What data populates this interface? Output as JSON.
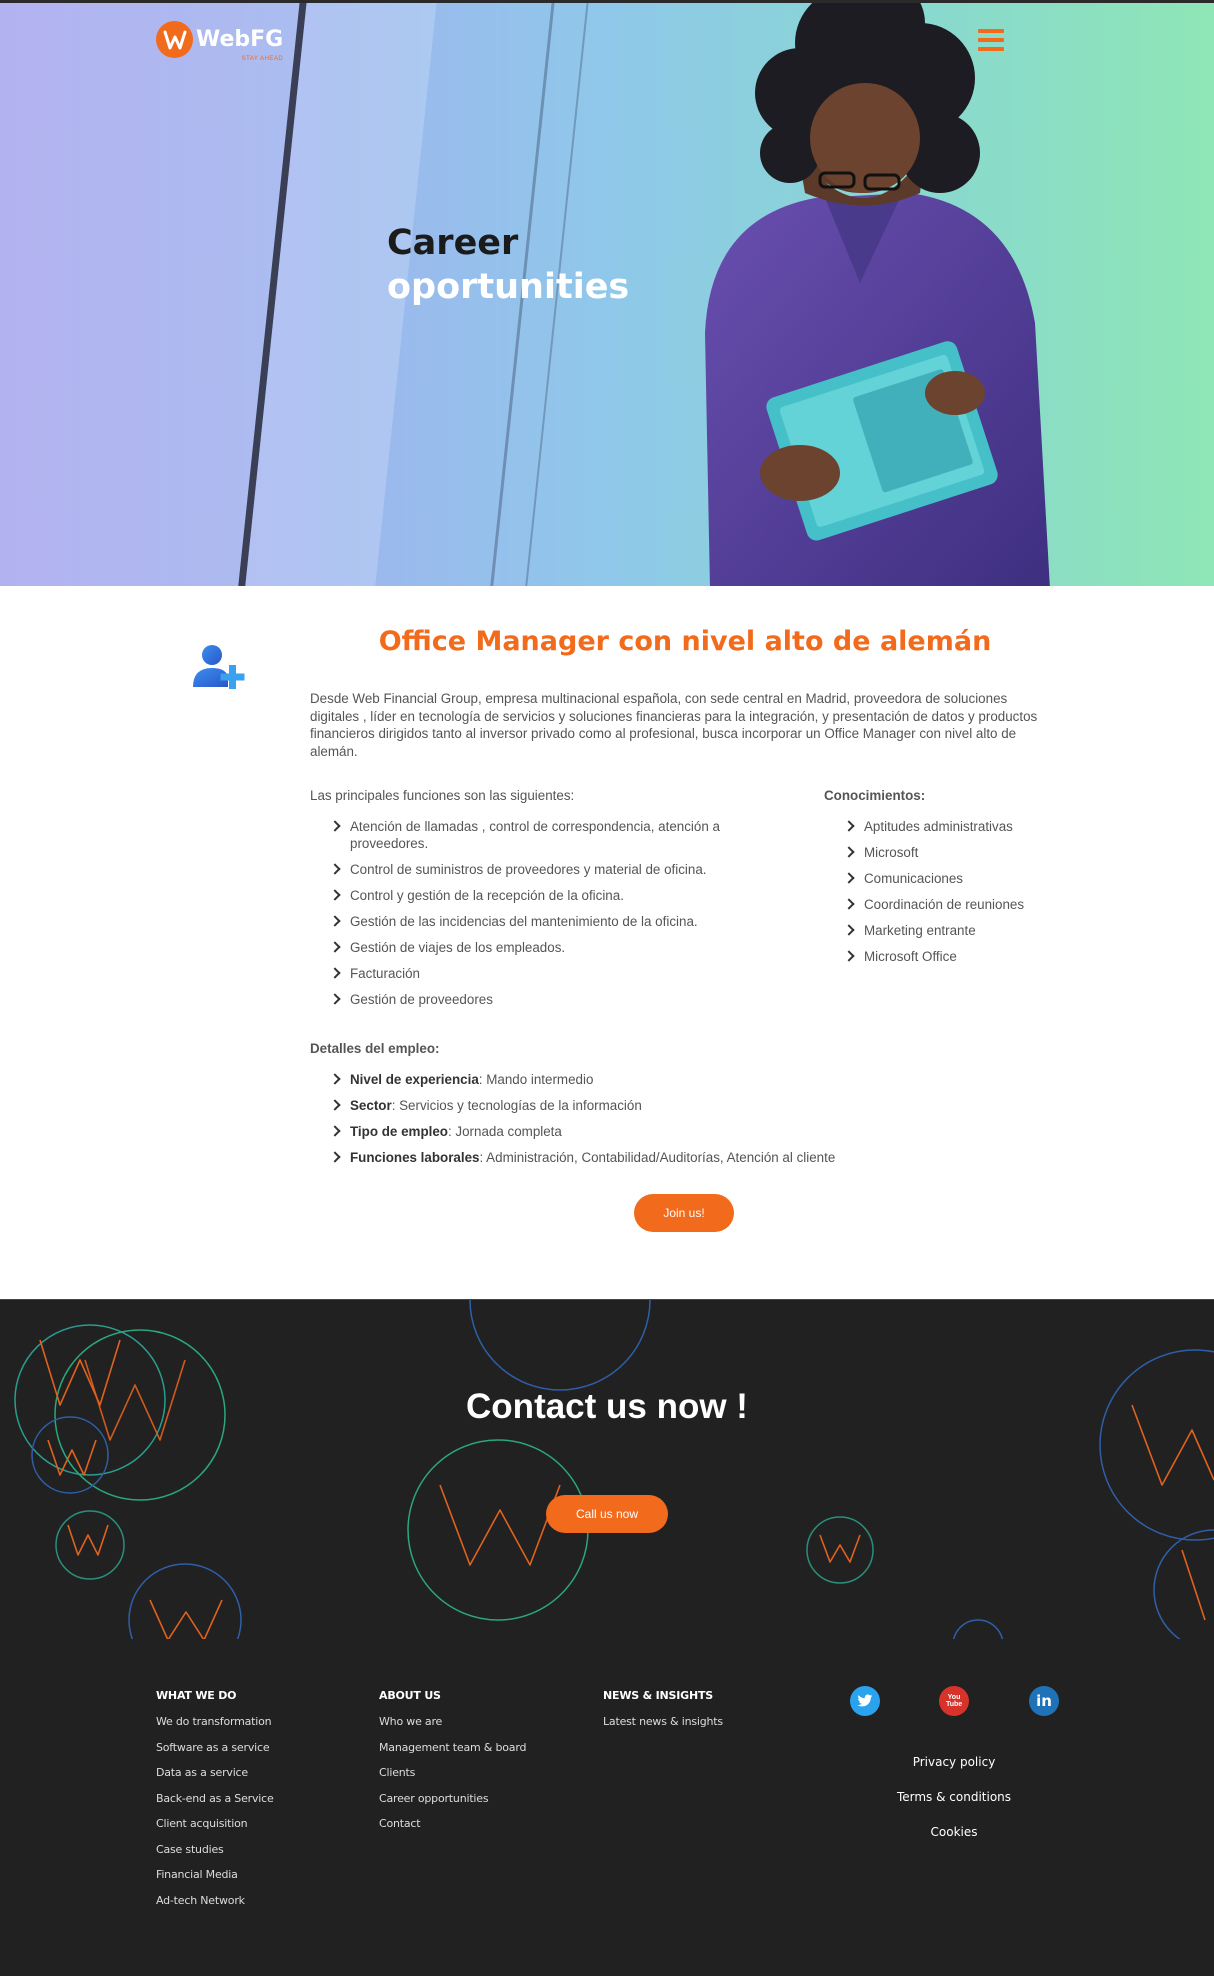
{
  "header": {
    "logo_name": "WebFG",
    "logo_tagline": "STAY AHEAD",
    "menu_icon": "hamburger-icon"
  },
  "hero": {
    "title_line1": "Career",
    "title_line2": "oportunities"
  },
  "job": {
    "icon": "add-user-icon",
    "title": "Office Manager con nivel alto de alemán",
    "intro": "Desde Web Financial Group, empresa multinacional española, con sede central en Madrid, proveedora de soluciones digitales , líder en tecnología de servicios y soluciones financieras para la integración, y presentación de datos y productos financieros dirigidos tanto al inversor privado como al profesional, busca incorporar un Office Manager con nivel alto de alemán.",
    "functions_heading": "Las principales funciones son las siguientes:",
    "functions": [
      "Atención de llamadas , control de correspondencia, atención a proveedores.",
      "Control de suministros de proveedores y material de oficina.",
      "Control y gestión de la recepción de la oficina.",
      "Gestión de las incidencias del mantenimiento de la oficina.",
      "Gestión de viajes de los empleados.",
      "Facturación",
      "Gestión de proveedores"
    ],
    "knowledge_heading": "Conocimientos:",
    "knowledge": [
      "Aptitudes administrativas",
      "Microsoft",
      "Comunicaciones",
      "Coordinación de reuniones",
      "Marketing entrante",
      "Microsoft Office"
    ],
    "details_heading": "Detalles del empleo:",
    "details": [
      {
        "label": "Nivel de experiencia",
        "value": ": Mando intermedio"
      },
      {
        "label": "Sector",
        "value": ": Servicios y tecnologías de la información"
      },
      {
        "label": "Tipo de empleo",
        "value": ": Jornada completa"
      },
      {
        "label": "Funciones laborales",
        "value": ": Administración, Contabilidad/Auditorías, Atención al cliente"
      }
    ],
    "join_label": "Join us!"
  },
  "contact": {
    "title": "Contact us now !",
    "call_label": "Call us now"
  },
  "footer": {
    "col1": {
      "heading": "WHAT WE DO",
      "links": [
        "We do transformation",
        "Software as a service",
        "Data as a service",
        "Back-end as a Service",
        "Client acquisition",
        "Case studies",
        "Financial Media",
        "Ad-tech Network"
      ]
    },
    "col2": {
      "heading": "ABOUT US",
      "links": [
        "Who we are",
        "Management team & board",
        "Clients",
        "Career opportunities",
        "Contact"
      ]
    },
    "col3": {
      "heading": "NEWS & INSIGHTS",
      "links": [
        "Latest news & insights"
      ]
    },
    "social": {
      "twitter": "twitter-icon",
      "youtube": "youtube-icon",
      "youtube_text": "You Tube",
      "linkedin": "linkedin-icon",
      "linkedin_text": "in"
    },
    "legal": [
      "Privacy policy",
      "Terms & conditions",
      "Cookies"
    ]
  },
  "colors": {
    "accent": "#f26a1b",
    "dark": "#212121",
    "blue_icon": "#2a6fe0"
  }
}
